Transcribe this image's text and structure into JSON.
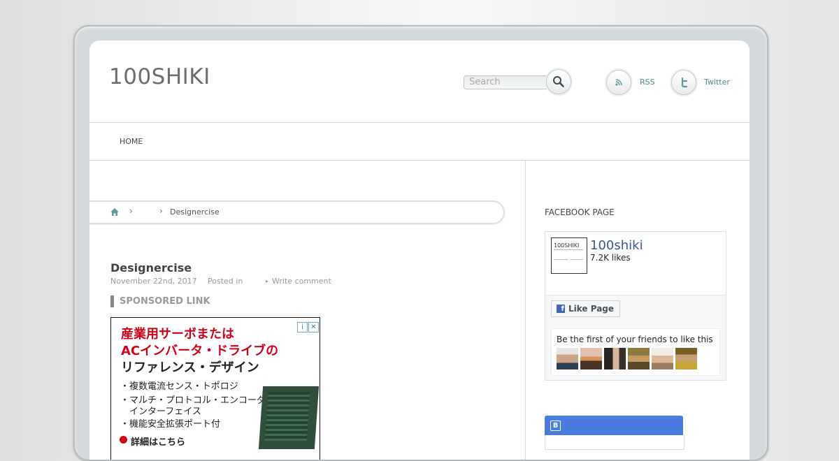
{
  "header": {
    "site_title": "100SHIKI",
    "search_placeholder": "Search",
    "rss_label": "RSS",
    "twitter_label": "Twitter"
  },
  "nav": {
    "items": [
      {
        "label": "HOME"
      }
    ]
  },
  "breadcrumb": {
    "current": "Designercise"
  },
  "post": {
    "title": "Designercise",
    "date": "November 22nd, 2017",
    "posted_in": "Posted in",
    "write_comment": "Write comment",
    "sponsored_label": "SPONSORED LINK"
  },
  "ad": {
    "line1": "産業用サーボまたは",
    "line2": "ACインバータ・ドライブの",
    "line3": "リファレンス・デザイン",
    "bullets": [
      "・複数電流センス・トポロジ",
      "・マルチ・プロトコル・エンコーダ",
      "　インターフェイス",
      "・機能安全拡張ポート付"
    ],
    "cta": "詳細はこちら"
  },
  "sidebar": {
    "facebook_heading": "FACEBOOK PAGE",
    "fb_page_name": "100shiki",
    "fb_likes": "7.2K likes",
    "fb_like_button": "Like Page",
    "fb_friends_text": "Be the first of your friends to like this",
    "fb_thumb_text": "100SHIKI"
  },
  "colors": {
    "link": "#4a8a8a",
    "facebook_blue": "#4267b2",
    "hatena_blue": "#4a7bde",
    "ad_red": "#d0021b"
  }
}
